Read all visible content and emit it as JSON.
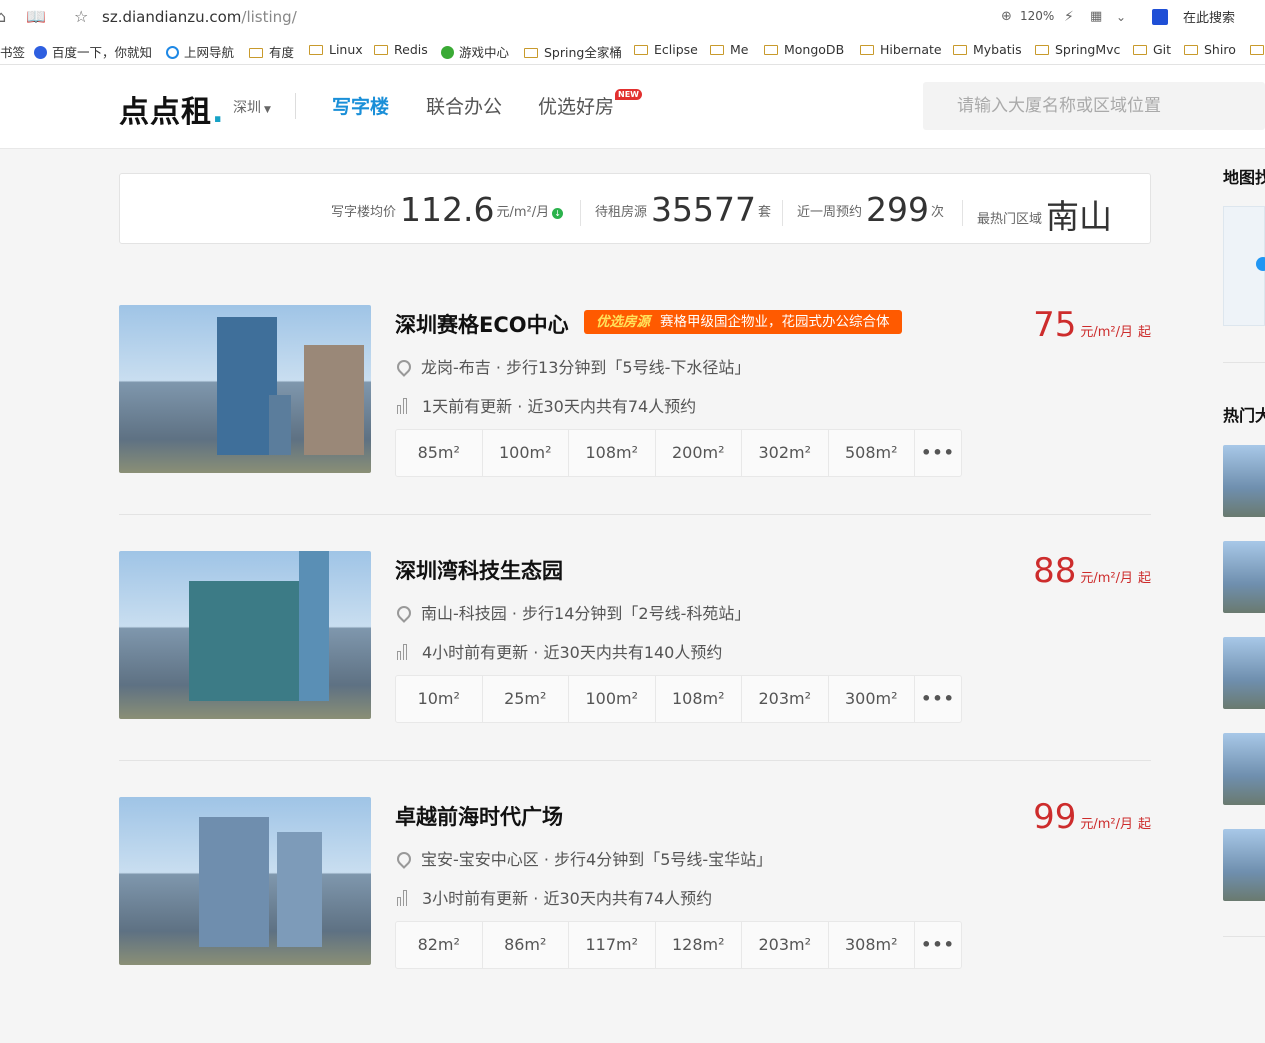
{
  "browser": {
    "url_host": "sz.diandianzu.com",
    "url_path": "/listing/",
    "zoom": "120%",
    "search_engine_label": "在此搜索",
    "bookmarks": [
      "书签",
      "百度一下，你就知",
      "上网导航",
      "有度",
      "Linux",
      "Redis",
      "游戏中心",
      "Spring全家桶",
      "Eclipse",
      "Me",
      "MongoDB",
      "Hibernate",
      "Mybatis",
      "SpringMvc",
      "Git",
      "Shiro"
    ]
  },
  "header": {
    "logo": "点点租",
    "city": "深圳",
    "nav": [
      "写字楼",
      "联合办公",
      "优选好房"
    ],
    "new_badge": "NEW",
    "search_placeholder": "请输入大厦名称或区域位置"
  },
  "stats": {
    "avg_label": "写字楼均价",
    "avg_value": "112.6",
    "avg_unit": "元/m²/月",
    "listing_label": "待租房源",
    "listing_value": "35577",
    "listing_unit": "套",
    "booking_label": "近一周预约",
    "booking_value": "299",
    "booking_unit": "次",
    "hot_label": "最热门区域",
    "hot_value": "南山"
  },
  "listings": [
    {
      "title": "深圳赛格ECO中心",
      "badge_tag": "优选房源",
      "badge_text": "赛格甲级国企物业，花园式办公综合体",
      "price": "75",
      "price_unit": "元/m²/月",
      "price_suffix": "起",
      "location": "龙岗-布吉 · 步行13分钟到「5号线-下水径站」",
      "update": "1天前有更新",
      "bookings": "· 近30天内共有74人预约",
      "areas": [
        "85m²",
        "100m²",
        "108m²",
        "200m²",
        "302m²",
        "508m²"
      ]
    },
    {
      "title": "深圳湾科技生态园",
      "price": "88",
      "price_unit": "元/m²/月",
      "price_suffix": "起",
      "location": "南山-科技园 · 步行14分钟到「2号线-科苑站」",
      "update": "4小时前有更新",
      "bookings": "· 近30天内共有140人预约",
      "areas": [
        "10m²",
        "25m²",
        "100m²",
        "108m²",
        "203m²",
        "300m²"
      ]
    },
    {
      "title": "卓越前海时代广场",
      "price": "99",
      "price_unit": "元/m²/月",
      "price_suffix": "起",
      "location": "宝安-宝安中心区 · 步行4分钟到「5号线-宝华站」",
      "update": "3小时前有更新",
      "bookings": "· 近30天内共有74人预约",
      "areas": [
        "82m²",
        "86m²",
        "117m²",
        "128m²",
        "203m²",
        "308m²"
      ]
    }
  ],
  "more_label": "•••",
  "rail": {
    "map_heading": "地图找",
    "hot_heading": "热门大"
  },
  "colors": {
    "accent": "#1a8fd8",
    "price": "#cd2c2c",
    "badge": "#ff5a00"
  }
}
